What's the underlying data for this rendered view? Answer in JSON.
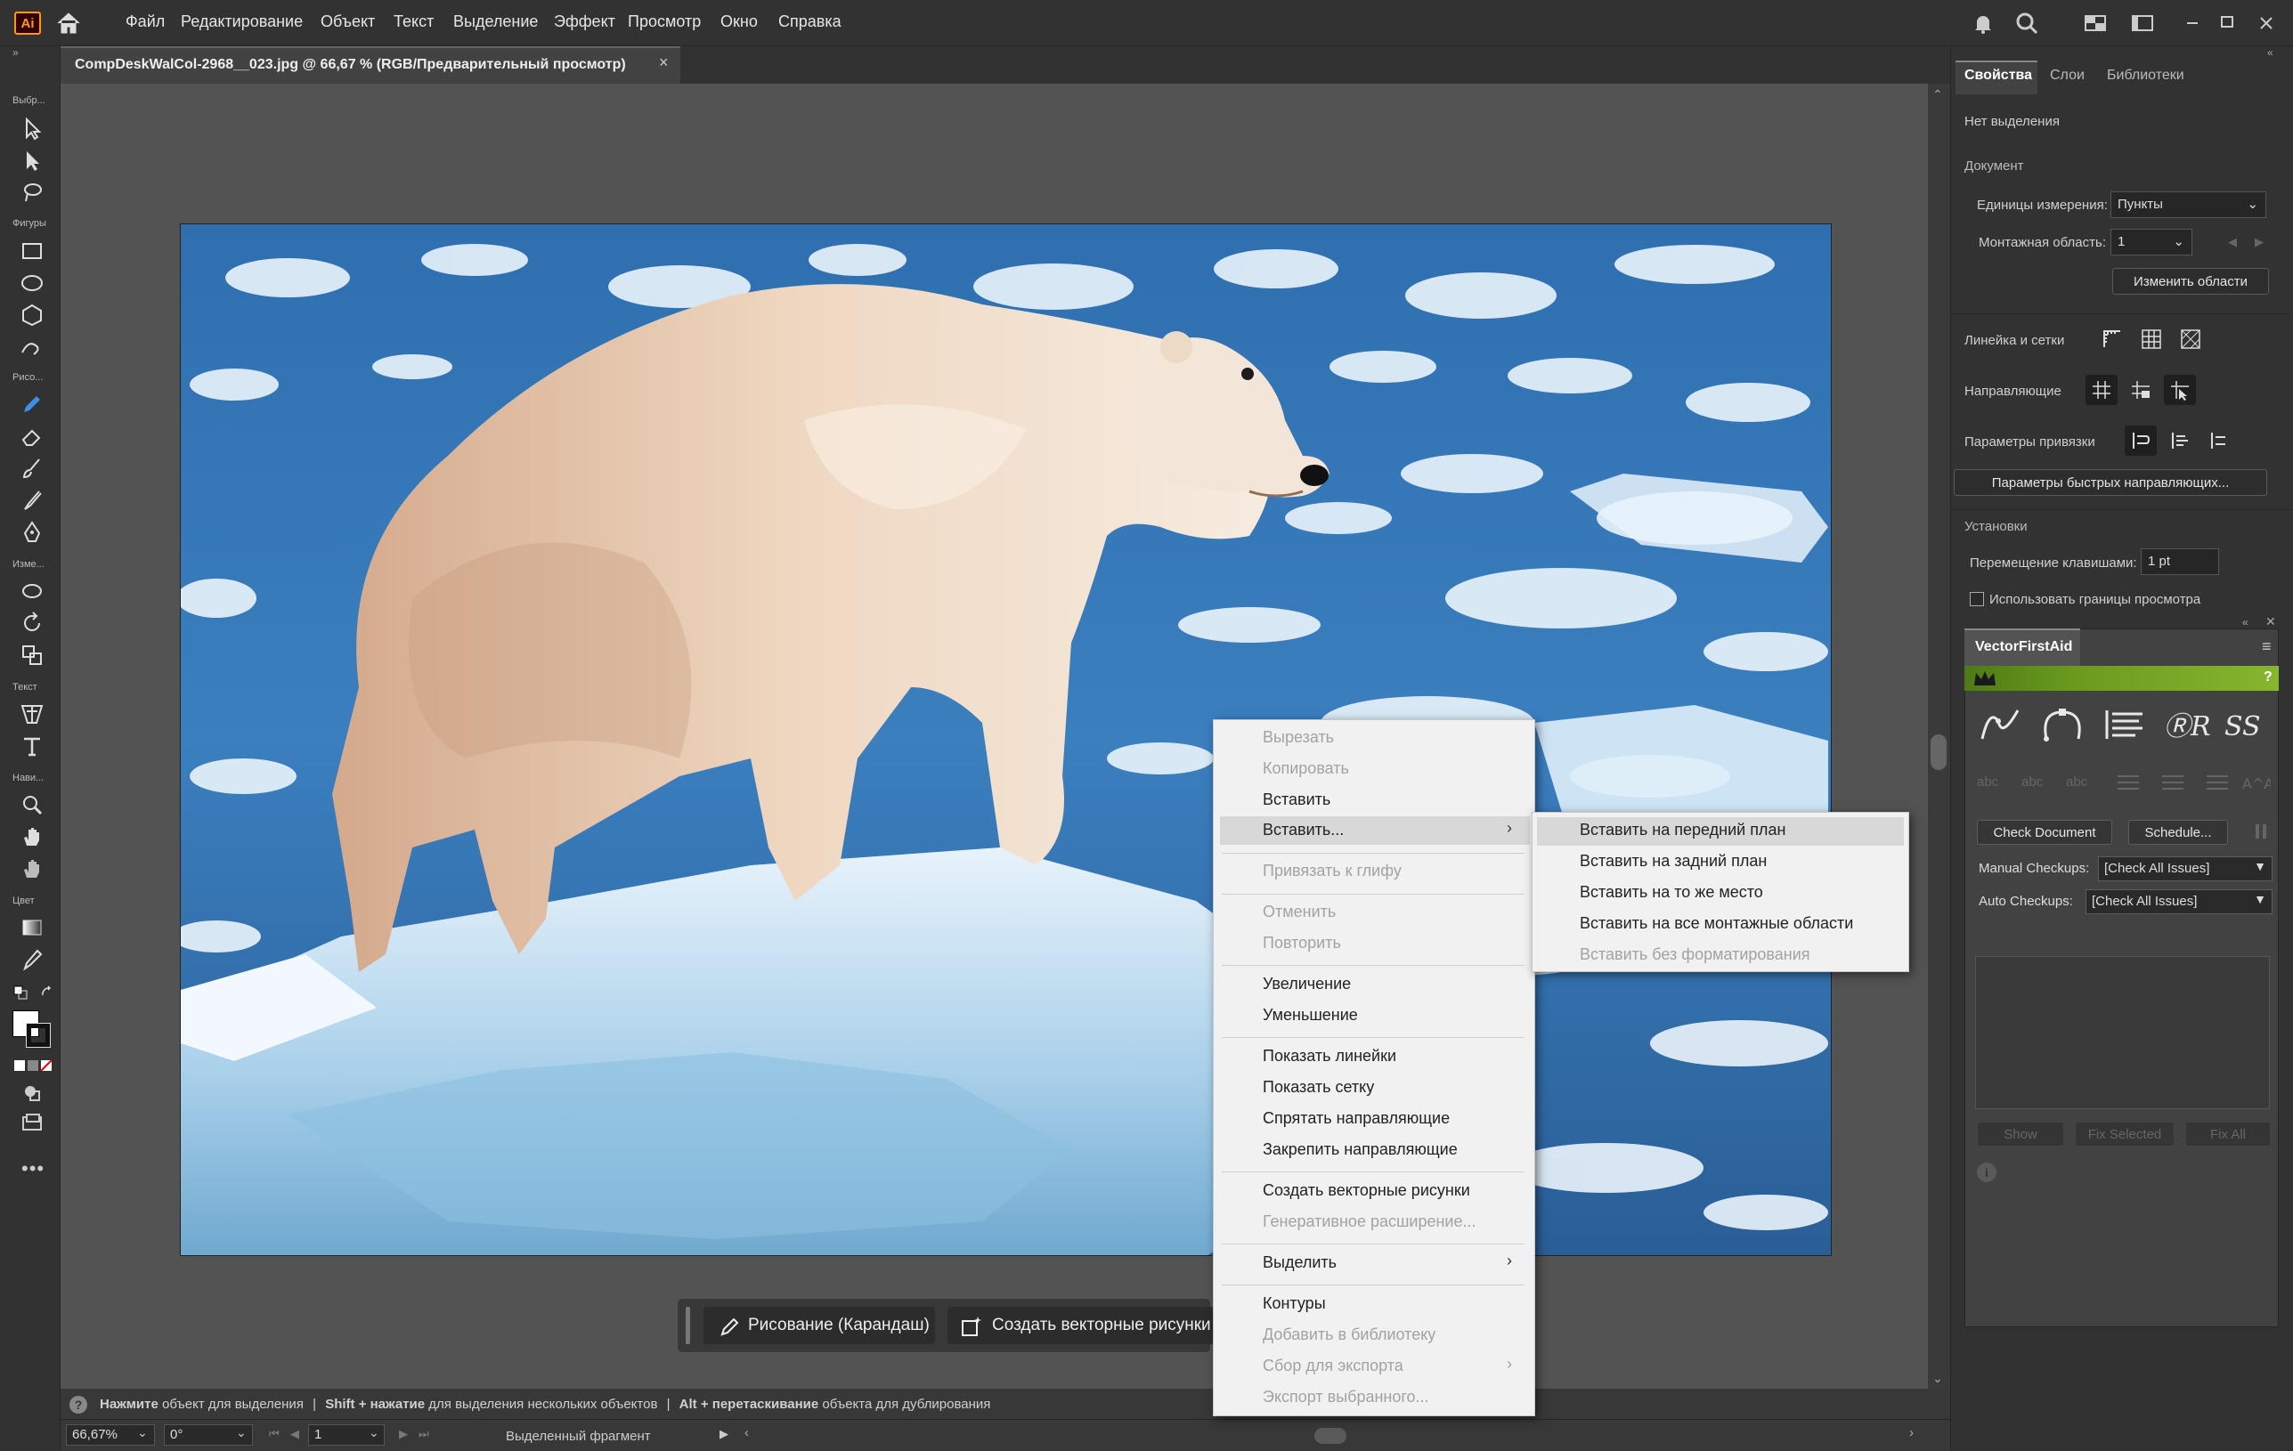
{
  "app": {
    "logo": "Ai"
  },
  "menu": [
    "Файл",
    "Редактирование",
    "Объект",
    "Текст",
    "Выделение",
    "Эффект",
    "Просмотр",
    "Окно",
    "Справка"
  ],
  "toolbar_labels": {
    "select": "Выбр...",
    "shapes": "Фигуры",
    "draw": "Рисо...",
    "modify": "Изме...",
    "text": "Текст",
    "navigate": "Нави...",
    "color": "Цвет"
  },
  "document": {
    "tab_title": "CompDeskWalCol-2968__023.jpg @ 66,67 % (RGB/Предварительный просмотр)",
    "close": "×"
  },
  "hint": {
    "click_bold": "Нажмите",
    "click_rest": " объект для выделения",
    "sep": "|",
    "shift_bold": "Shift + нажатие",
    "shift_rest": " для выделения нескольких объектов",
    "alt_bold": "Alt + перетаскивание",
    "alt_rest": " объекта для дублирования"
  },
  "status": {
    "zoom": "66,67%",
    "rotation": "0°",
    "artboard": "1",
    "selection": "Выделенный фрагмент"
  },
  "taskbar": {
    "draw": "Рисование (Карандаш)",
    "vectorize": "Создать векторные рисунки"
  },
  "panel": {
    "tabs": [
      "Свойства",
      "Слои",
      "Библиотеки"
    ],
    "no_selection": "Нет выделения",
    "document_head": "Документ",
    "units_label": "Единицы измерения:",
    "units_value": "Пункты",
    "artboard_label": "Монтажная область:",
    "artboard_value": "1",
    "edit_artboards": "Изменить области",
    "rulers_label": "Линейка и сетки",
    "guides_label": "Направляющие",
    "snap_label": "Параметры привязки",
    "smart_guides_btn": "Параметры быстрых направляющих...",
    "prefs_head": "Установки",
    "nudge_label": "Перемещение клавишами:",
    "nudge_value": "1 pt",
    "preview_bounds": "Использовать границы просмотра"
  },
  "vfa": {
    "title": "VectorFirstAid",
    "help": "?",
    "check_document": "Check Document",
    "schedule": "Schedule...",
    "manual_label": "Manual Checkups:",
    "manual_value": "[Check All Issues]",
    "auto_label": "Auto Checkups:",
    "auto_value": "[Check All Issues]",
    "show": "Show",
    "fix_selected": "Fix Selected",
    "fix_all": "Fix All",
    "dim_labels": [
      "abc",
      "abc",
      "abc"
    ]
  },
  "context_menu": {
    "items": [
      {
        "label": "Вырезать",
        "disabled": true
      },
      {
        "label": "Копировать",
        "disabled": true
      },
      {
        "label": "Вставить",
        "disabled": false
      },
      {
        "label": "Вставить...",
        "disabled": false
      },
      {
        "label": "Привязать к глифу",
        "disabled": true
      },
      {
        "label": "Отменить",
        "disabled": true
      },
      {
        "label": "Повторить",
        "disabled": true
      },
      {
        "label": "Увеличение",
        "disabled": false
      },
      {
        "label": "Уменьшение",
        "disabled": false
      },
      {
        "label": "Показать линейки",
        "disabled": false
      },
      {
        "label": "Показать сетку",
        "disabled": false
      },
      {
        "label": "Спрятать направляющие",
        "disabled": false
      },
      {
        "label": "Закрепить направляющие",
        "disabled": false
      },
      {
        "label": "Создать векторные рисунки",
        "disabled": false
      },
      {
        "label": "Генеративное расширение...",
        "disabled": true
      },
      {
        "label": "Выделить",
        "disabled": false
      },
      {
        "label": "Контуры",
        "disabled": false
      },
      {
        "label": "Добавить в библиотеку",
        "disabled": true
      },
      {
        "label": "Сбор для экспорта",
        "disabled": true
      },
      {
        "label": "Экспорт выбранного...",
        "disabled": true
      }
    ],
    "submenu": [
      {
        "label": "Вставить на передний план",
        "disabled": false
      },
      {
        "label": "Вставить на задний план",
        "disabled": false
      },
      {
        "label": "Вставить на то же место",
        "disabled": false
      },
      {
        "label": "Вставить на все монтажные области",
        "disabled": false
      },
      {
        "label": "Вставить без форматирования",
        "disabled": true
      }
    ]
  },
  "colors": {
    "accent_green": "#6a9b1f",
    "menu_bg": "#f1f1f1",
    "chrome": "#323232"
  }
}
